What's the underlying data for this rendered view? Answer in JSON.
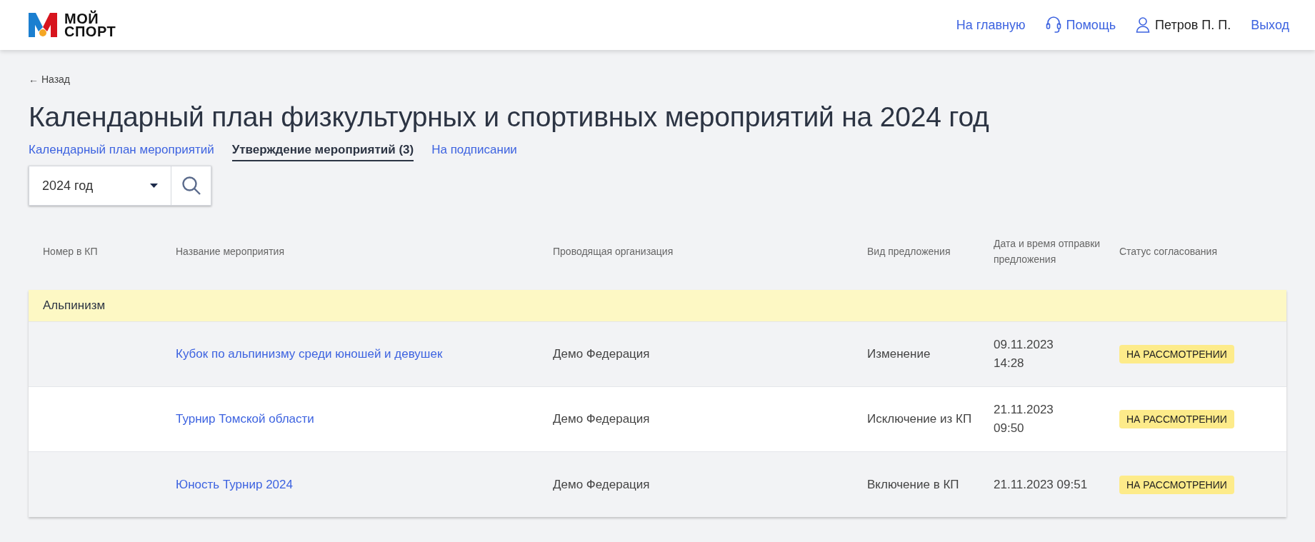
{
  "header": {
    "logo_text": [
      "МОЙ",
      "СПОРТ"
    ],
    "nav": [
      {
        "kind": "link",
        "label": "На главную"
      },
      {
        "kind": "help",
        "label": "Помощь"
      },
      {
        "kind": "user",
        "label": "Петров П. П."
      },
      {
        "kind": "link",
        "label": "Выход"
      }
    ]
  },
  "back_link": "← Назад",
  "title": "Календарный план физкультурных и спортивных мероприятий на 2024 год",
  "tabs": [
    {
      "label": "Календарный план мероприятий",
      "selected": false
    },
    {
      "label": "Утверждение мероприятий (3)",
      "selected": true
    },
    {
      "label": "На подписании",
      "selected": false
    }
  ],
  "filter": {
    "year": "2024 год"
  },
  "table": {
    "columns": [
      "Номер в КП",
      "Название мероприятия",
      "Проводящая организация",
      "Вид предложения",
      "Дата и время отправки предложения",
      "Статус согласования"
    ],
    "groups": [
      {
        "name": "Альпинизм",
        "rows": [
          {
            "event": "Кубок по альпинизму среди юношей и девушек",
            "organization": "Демо Федерация",
            "proposal": "Изменение",
            "sent": [
              "09.11.2023",
              "14:28"
            ],
            "status": "НА РАССМОТРЕНИИ"
          },
          {
            "event": "Турнир Томской области",
            "organization": "Демо Федерация",
            "proposal": "Исключение из КП",
            "sent": [
              "21.11.2023",
              "09:50"
            ],
            "status": "НА РАССМОТРЕНИИ"
          },
          {
            "event": "Юность Турнир 2024",
            "organization": "Демо Федерация",
            "proposal": "Включение в КП",
            "sent": [
              "21.11.2023 09:51"
            ],
            "status": "НА РАССМОТРЕНИИ"
          }
        ]
      }
    ]
  }
}
